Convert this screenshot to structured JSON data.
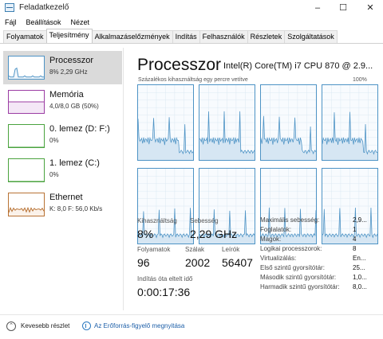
{
  "window": {
    "title": "Feladatkezelő",
    "minimize": "–",
    "maximize": "☐",
    "close": "✕"
  },
  "menu": [
    "Fájl",
    "Beállítások",
    "Nézet"
  ],
  "tabs": [
    "Folyamatok",
    "Teljesítmény",
    "Alkalmazáselőzmények",
    "Indítás",
    "Felhasználók",
    "Részletek",
    "Szolgáltatások"
  ],
  "active_tab": "Teljesítmény",
  "sidebar": [
    {
      "title": "Processzor",
      "sub": "8% 2,29 GHz",
      "color": "#4d93c5",
      "fill": "#f1f6fb",
      "level": 0.08,
      "selected": true
    },
    {
      "title": "Memória",
      "sub": "4,0/8,0 GB (50%)",
      "color": "#9b3ca3",
      "fill": "#f4e7f6",
      "level": 0.5,
      "selected": false
    },
    {
      "title": "0. lemez (D: F:)",
      "sub": "0%",
      "color": "#4aa33e",
      "fill": "#ffffff",
      "level": 0.0,
      "selected": false
    },
    {
      "title": "1. lemez (C:)",
      "sub": "0%",
      "color": "#4aa33e",
      "fill": "#ffffff",
      "level": 0.0,
      "selected": false
    },
    {
      "title": "Ethernet",
      "sub": "K: 8,0 F: 56,0 Kb/s",
      "color": "#b87234",
      "fill": "#fbf2ea",
      "level": 0.35,
      "selected": false
    }
  ],
  "main": {
    "title": "Processzor",
    "cpu_name": "Intel(R) Core(TM) i7 CPU 870 @ 2.9...",
    "util_label": "Százalékos kihasználtság egy percre vetítve",
    "util_max": "100%"
  },
  "stats": {
    "util_label": "Kihasználtság",
    "util_value": "8%",
    "speed_label": "Sebesség",
    "speed_value": "2,29 GHz",
    "proc_label": "Folyamatok",
    "proc_value": "96",
    "threads_label": "Szálak",
    "threads_value": "2002",
    "handles_label": "Leírók",
    "handles_value": "56407",
    "uptime_label": "Indítás óta eltelt idő",
    "uptime_value": "0:00:17:36"
  },
  "specs": [
    {
      "label": "Maximális sebesség:",
      "value": "2,9..."
    },
    {
      "label": "Foglalatok:",
      "value": "1"
    },
    {
      "label": "Magok:",
      "value": "4"
    },
    {
      "label": "Logikai processzorok:",
      "value": "8"
    },
    {
      "label": "Virtualizálás:",
      "value": "En..."
    },
    {
      "label": "Első szintű gyorsítótár:",
      "value": "25..."
    },
    {
      "label": "Második szintű gyorsítótár:",
      "value": "1,0..."
    },
    {
      "label": "Harmadik szintű gyorsítótár:",
      "value": "8,0..."
    }
  ],
  "footer": {
    "fewer": "Kevesebb részlet",
    "monitor": "Az Erőforrás-figyelő megnyitása"
  },
  "colors": {
    "cpu_line": "#4d93c5",
    "cpu_fill": "#d6e6f3",
    "link": "#1d5fa8"
  }
}
